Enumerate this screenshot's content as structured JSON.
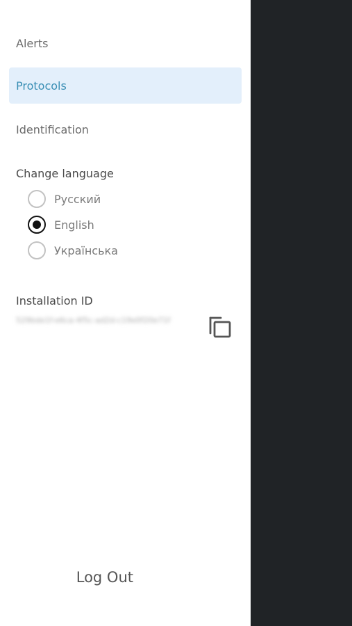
{
  "menu": {
    "items": [
      {
        "label": "Alerts",
        "active": false
      },
      {
        "label": "Protocols",
        "active": true
      },
      {
        "label": "Identification",
        "active": false
      }
    ]
  },
  "language": {
    "title": "Change language",
    "options": [
      {
        "label": "Русский",
        "selected": false
      },
      {
        "label": "English",
        "selected": true
      },
      {
        "label": "Українська",
        "selected": false
      }
    ]
  },
  "installation": {
    "title": "Installation ID",
    "value": "529bde1f-e6ca-4f5c-ad2d-c19e0f20e71f",
    "copy_icon": "copy-icon"
  },
  "logout_label": "Log Out",
  "colors": {
    "active_bg": "#e3effb",
    "active_text": "#3a8fb5",
    "scrim": "#202326",
    "radio_checked": "#111111"
  }
}
